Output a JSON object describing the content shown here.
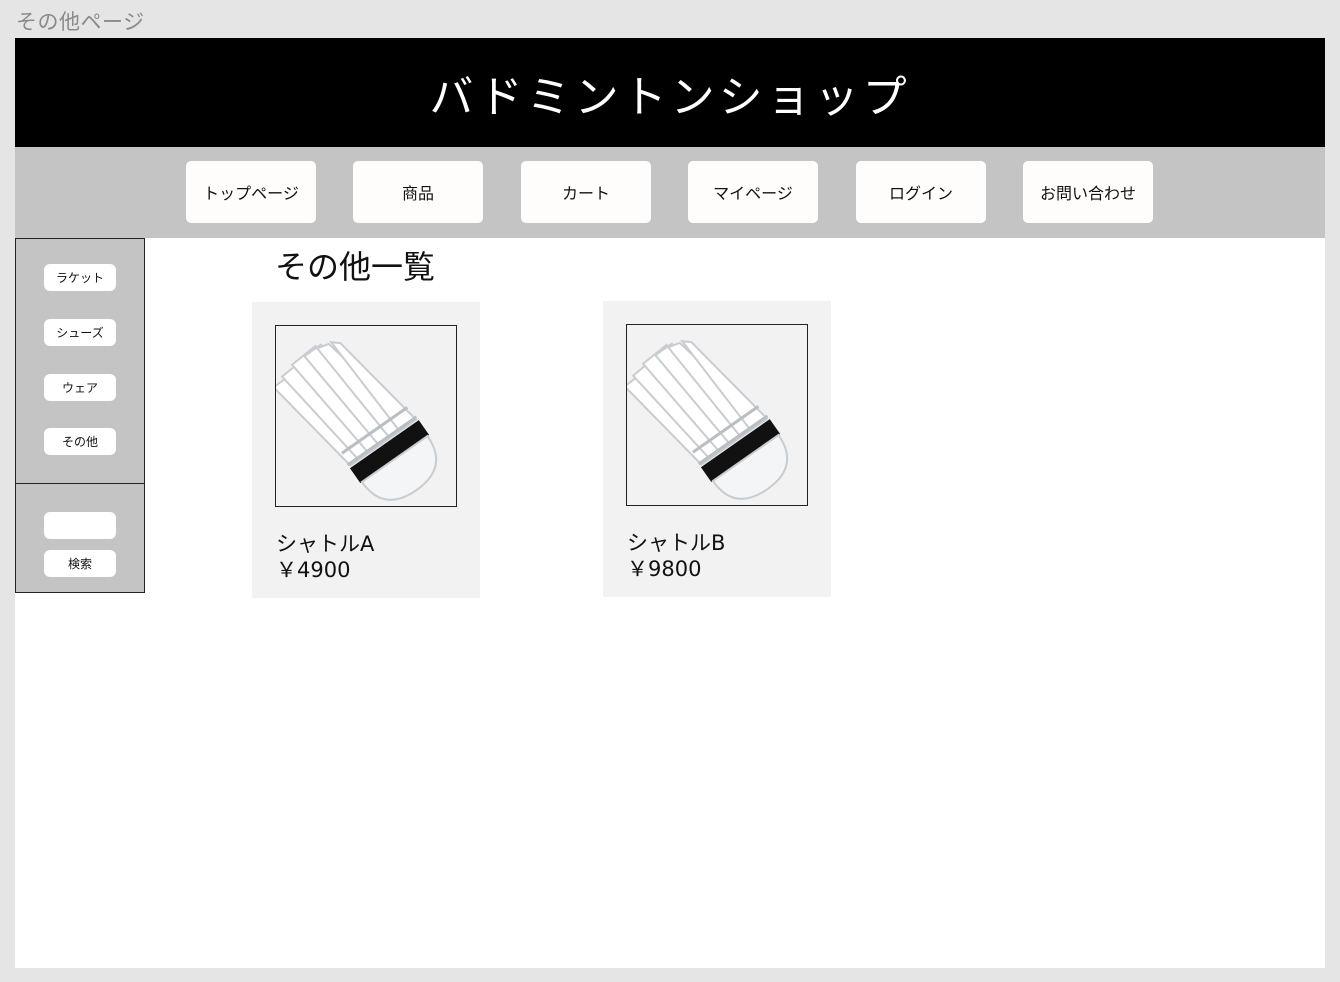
{
  "page_label": "その他ページ",
  "header": {
    "title": "バドミントンショップ"
  },
  "nav": [
    {
      "label": "トップページ"
    },
    {
      "label": "商品"
    },
    {
      "label": "カート"
    },
    {
      "label": "マイページ"
    },
    {
      "label": "ログイン"
    },
    {
      "label": "お問い合わせ"
    }
  ],
  "sidebar": {
    "categories": [
      {
        "label": "ラケット"
      },
      {
        "label": "シューズ"
      },
      {
        "label": "ウェア"
      },
      {
        "label": "その他"
      }
    ],
    "search": {
      "value": "",
      "button_label": "検索"
    }
  },
  "main": {
    "title": "その他一覧",
    "products": [
      {
        "name": "シャトルA",
        "price": "￥4900",
        "icon": "shuttlecock-icon"
      },
      {
        "name": "シャトルB",
        "price": "￥9800",
        "icon": "shuttlecock-icon"
      }
    ]
  }
}
